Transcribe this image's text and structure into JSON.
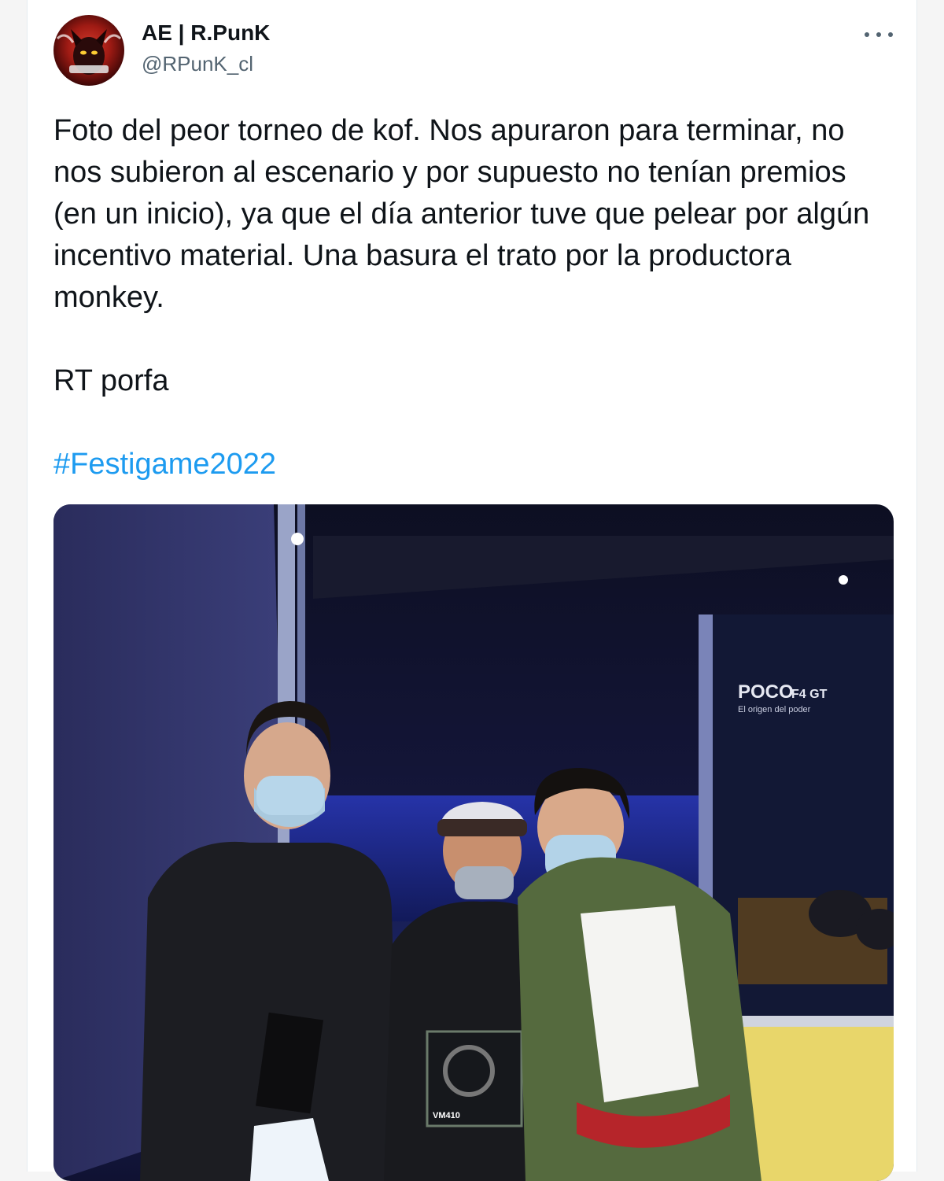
{
  "tweet": {
    "author": {
      "display_name": "AE | R.PunK",
      "handle": "@RPunK_cl"
    },
    "more_icon": "more-horizontal-icon",
    "paragraphs": [
      "Foto del peor torneo de kof. Nos apuraron para terminar, no nos subieron al escenario y por supuesto no tenían premios (en un inicio), ya que el día anterior tuve que pelear por algún incentivo material. Una basura el trato por la productora monkey.",
      "RT porfa"
    ],
    "hashtag": "#Festigame2022",
    "media": {
      "banner_title": "POCO",
      "banner_model": "F4 GT",
      "banner_subtitle": "El origen del poder",
      "headset_box_label": "VM410"
    }
  },
  "colors": {
    "link": "#1d9bf0",
    "text": "#0f1419",
    "secondary": "#536471"
  }
}
